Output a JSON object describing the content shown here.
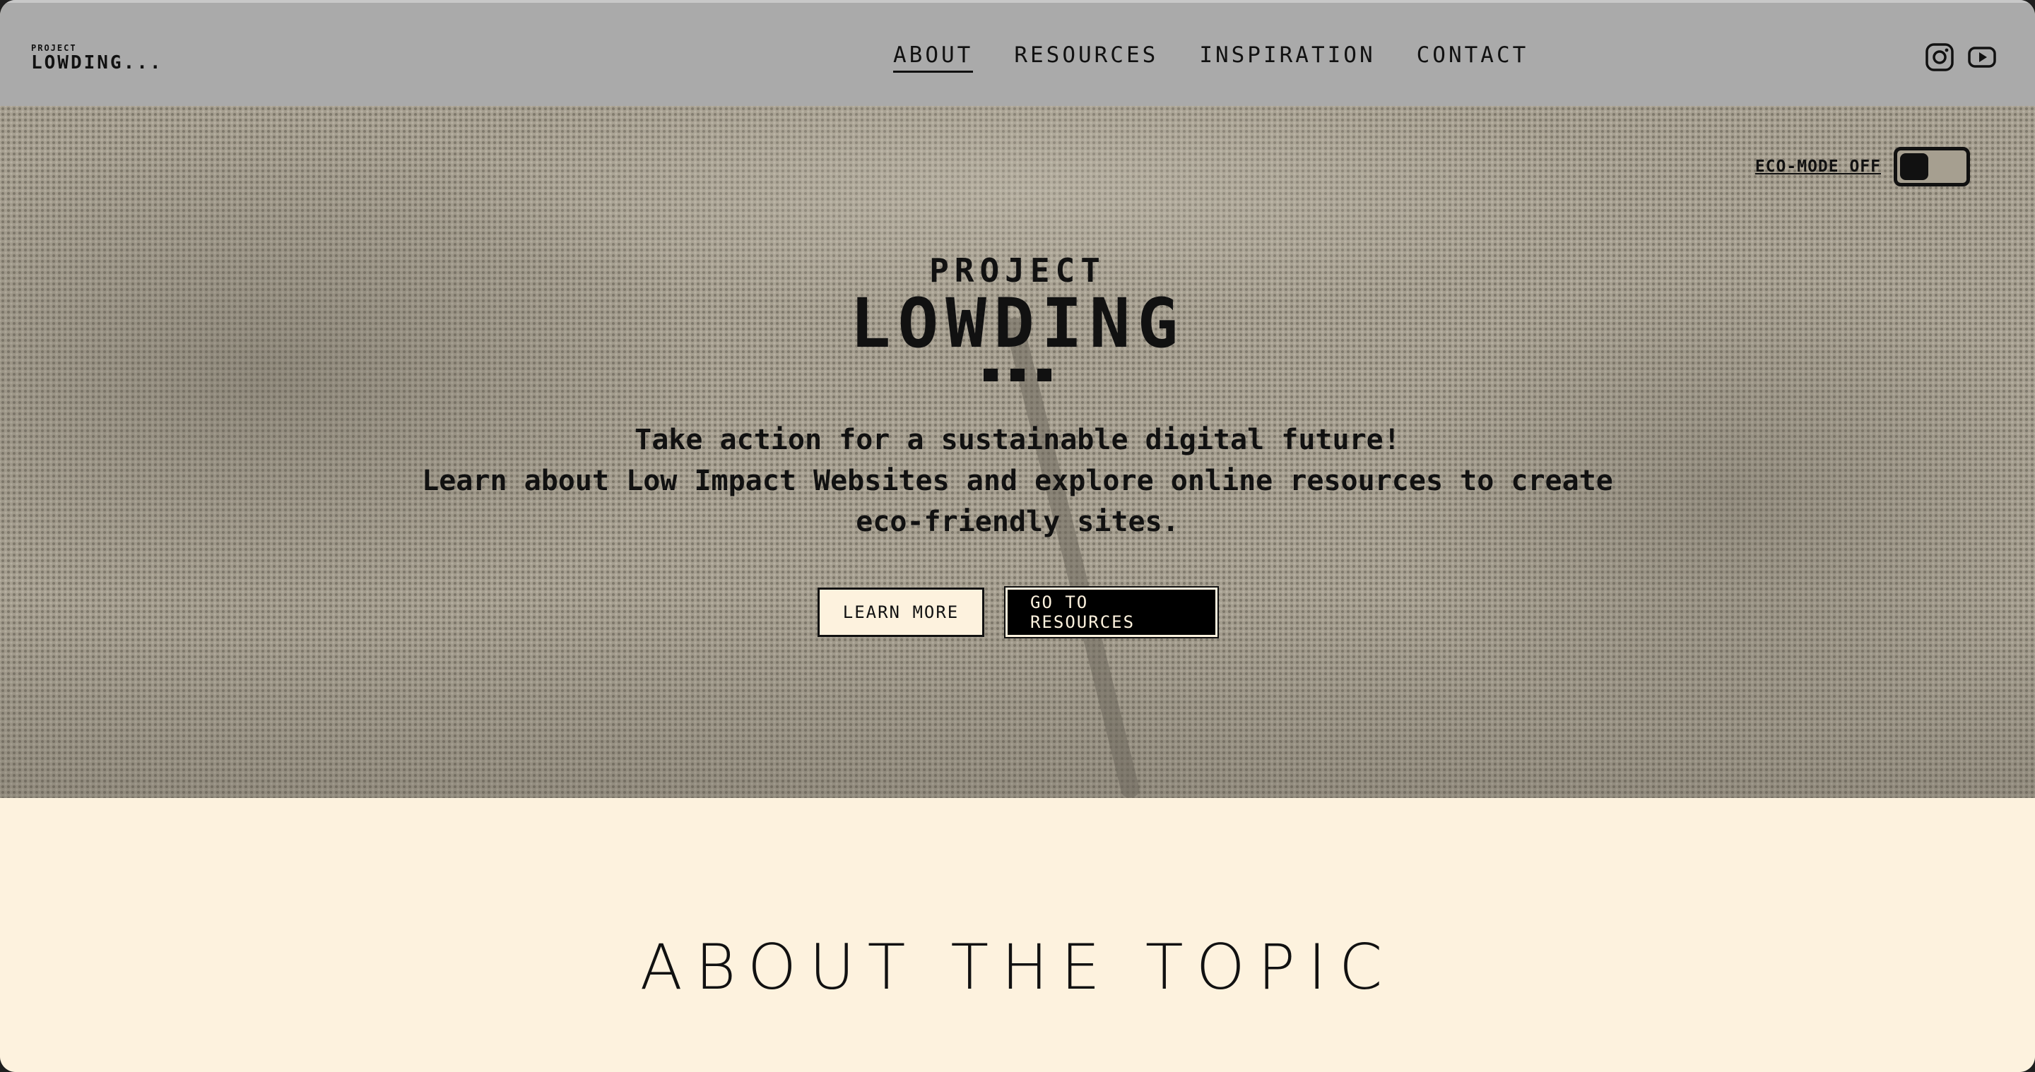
{
  "header": {
    "logo_small": "PROJECT",
    "logo_big": "LOWDING...",
    "nav": [
      {
        "label": "ABOUT",
        "active": true
      },
      {
        "label": "RESOURCES",
        "active": false
      },
      {
        "label": "INSPIRATION",
        "active": false
      },
      {
        "label": "CONTACT",
        "active": false
      }
    ],
    "social_icons": [
      "instagram-icon",
      "youtube-icon"
    ]
  },
  "hero": {
    "eco_mode_label": "ECO-MODE OFF",
    "eco_mode_on": false,
    "title_small": "PROJECT",
    "title_big": "LOWDING",
    "tagline": "Take action for a sustainable digital future!",
    "description_line1": "Learn about Low Impact Websites and explore online resources to create",
    "description_line2": "eco-friendly sites.",
    "learn_more_label": "LEARN MORE",
    "go_resources_label": "GO TO RESOURCES"
  },
  "about": {
    "title": "ABOUT THE TOPIC"
  },
  "colors": {
    "header_bg": "#aaaaaa",
    "hero_bg": "#a69f90",
    "cream": "#fdf2de",
    "ink": "#111111"
  }
}
